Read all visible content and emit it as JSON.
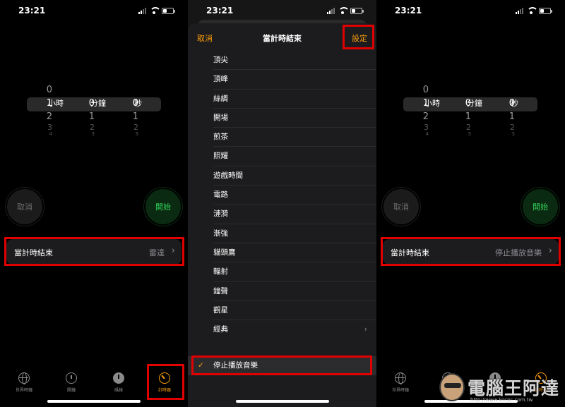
{
  "status": {
    "time": "23:21"
  },
  "timer_screen": {
    "picker": {
      "hours": {
        "above": "0",
        "selected": "1",
        "below": [
          "2",
          "3",
          "4"
        ],
        "unit": "小時"
      },
      "minutes": {
        "above": "",
        "selected": "0",
        "below": [
          "1",
          "2",
          "3"
        ],
        "unit": "分鐘"
      },
      "seconds": {
        "above": "",
        "selected": "0",
        "below": [
          "1",
          "2",
          "3"
        ],
        "unit": "秒"
      }
    },
    "cancel_label": "取消",
    "start_label": "開始",
    "end_row_label": "當計時結束"
  },
  "left_panel": {
    "end_value": "雷達"
  },
  "right_panel": {
    "end_value": "停止播放音樂"
  },
  "tabs": [
    {
      "label": "世界時鐘",
      "icon": "globe-icon"
    },
    {
      "label": "鬧鐘",
      "icon": "alarm-clock-icon"
    },
    {
      "label": "碼錶",
      "icon": "stopwatch-icon"
    },
    {
      "label": "計時器",
      "icon": "timer-icon",
      "active": true
    }
  ],
  "sheet": {
    "cancel": "取消",
    "title": "當計時結束",
    "set": "設定",
    "tones": [
      "頂尖",
      "頂峰",
      "絲綢",
      "開場",
      "煎茶",
      "照耀",
      "遊戲時間",
      "電路",
      "漣漪",
      "漸強",
      "貓頭鷹",
      "輻射",
      "鐘聲",
      "觀星",
      "經典"
    ],
    "stop_music": "停止播放音樂"
  },
  "colors": {
    "accent": "#ff9f0a",
    "start_green": "#30d158",
    "highlight_box": "#e00000"
  },
  "watermark": {
    "text": "電腦王阿達",
    "url": "http://www.kocpc.com.tw"
  }
}
